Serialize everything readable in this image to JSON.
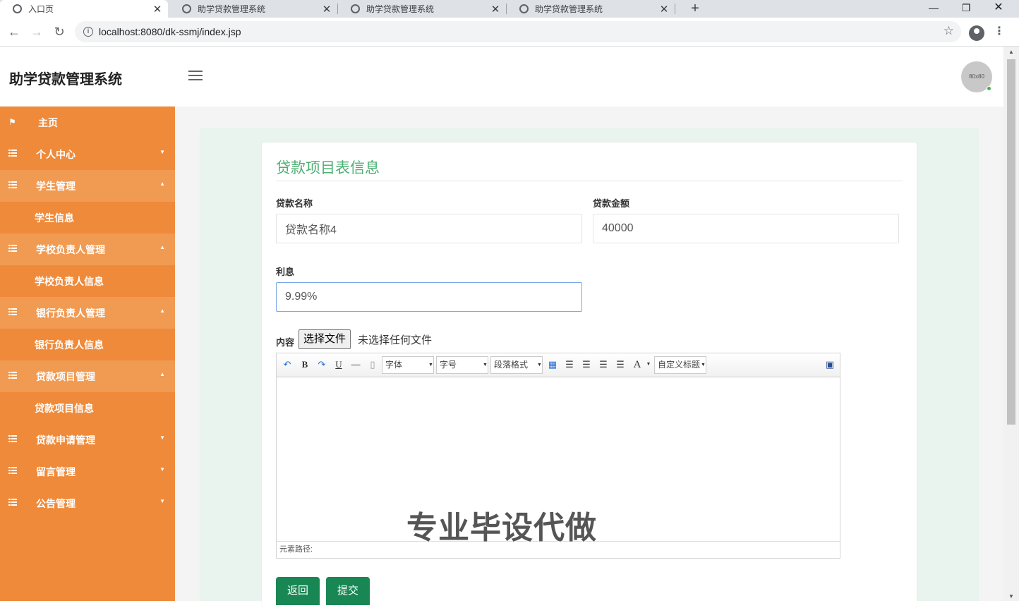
{
  "browser": {
    "tabs": [
      {
        "title": "入口页",
        "active": true
      },
      {
        "title": "助学贷款管理系统",
        "active": false
      },
      {
        "title": "助学贷款管理系统",
        "active": false
      },
      {
        "title": "助学贷款管理系统",
        "active": false
      }
    ],
    "url": "localhost:8080/dk-ssmj/index.jsp"
  },
  "header": {
    "logo": "助学贷款管理系统",
    "avatar_text": "80x80"
  },
  "sidebar": {
    "items": [
      {
        "label": "主页",
        "icon": "flag-icon"
      },
      {
        "label": "个人中心",
        "icon": "grid-icon"
      },
      {
        "label": "学生管理",
        "icon": "grid-icon",
        "open": true,
        "sub": "学生信息"
      },
      {
        "label": "学校负责人管理",
        "icon": "grid-icon",
        "open": true,
        "sub": "学校负责人信息"
      },
      {
        "label": "银行负责人管理",
        "icon": "grid-icon",
        "open": true,
        "sub": "银行负责人信息"
      },
      {
        "label": "贷款项目管理",
        "icon": "grid-icon",
        "open": true,
        "sub": "贷款项目信息"
      },
      {
        "label": "贷款申请管理",
        "icon": "grid-icon"
      },
      {
        "label": "留言管理",
        "icon": "grid-icon"
      },
      {
        "label": "公告管理",
        "icon": "grid-icon"
      }
    ]
  },
  "form": {
    "title": "贷款项目表信息",
    "name_label": "贷款名称",
    "name_value": "贷款名称4",
    "amount_label": "贷款金额",
    "amount_value": "40000",
    "interest_label": "利息",
    "interest_value": "9.99%",
    "content_label": "内容",
    "file_button": "选择文件",
    "file_status": "未选择任何文件",
    "editor": {
      "font_select": "字体",
      "size_select": "字号",
      "para_select": "段落格式",
      "custom_title": "自定义标题",
      "path_label": "元素路径:"
    },
    "back_button": "返回",
    "submit_button": "提交"
  },
  "watermark": "专业毕设代做",
  "colors": {
    "sidebar": "#ef8a3a",
    "accent_green": "#4caf72",
    "button_green": "#198754"
  }
}
